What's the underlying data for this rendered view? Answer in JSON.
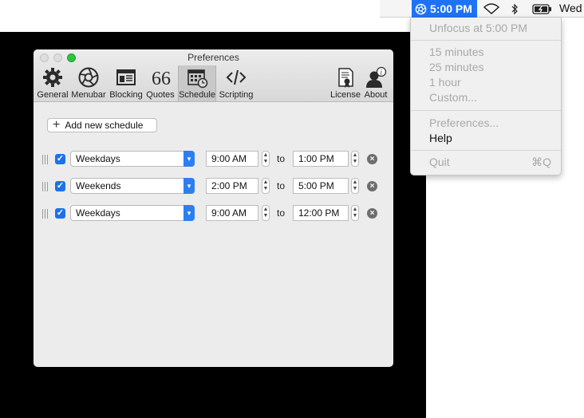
{
  "menubar": {
    "status_time": "5:00 PM",
    "clock": "Wed",
    "icons": [
      "focus-icon",
      "wifi-icon",
      "bluetooth-icon",
      "battery-icon"
    ]
  },
  "menu": {
    "unfocus_label": "Unfocus at 5:00 PM",
    "durations": [
      "15 minutes",
      "25 minutes",
      "1 hour",
      "Custom..."
    ],
    "preferences": "Preferences...",
    "help": "Help",
    "quit": "Quit",
    "quit_shortcut": "⌘Q"
  },
  "window": {
    "title": "Preferences",
    "toolbar": [
      {
        "label": "General",
        "icon": "gear-icon"
      },
      {
        "label": "Menubar",
        "icon": "aperture-icon"
      },
      {
        "label": "Blocking",
        "icon": "browser-window-icon"
      },
      {
        "label": "Quotes",
        "icon": "quote-icon"
      },
      {
        "label": "Schedule",
        "icon": "calendar-clock-icon"
      },
      {
        "label": "Scripting",
        "icon": "code-icon"
      },
      {
        "label": "License",
        "icon": "certificate-icon"
      },
      {
        "label": "About",
        "icon": "person-info-icon"
      }
    ],
    "selected_tab": "Schedule",
    "add_schedule_label": "Add new schedule",
    "schedules": [
      {
        "days": "Weekdays",
        "start": "9:00 AM",
        "to": "to",
        "end": "1:00 PM",
        "enabled": true
      },
      {
        "days": "Weekends",
        "start": "2:00 PM",
        "to": "to",
        "end": "5:00 PM",
        "enabled": true
      },
      {
        "days": "Weekdays",
        "start": "9:00 AM",
        "to": "to",
        "end": "12:00 PM",
        "enabled": true
      }
    ]
  },
  "colors": {
    "accent": "#1e73f5",
    "window_bg": "#ececec",
    "disabled_text": "#a8a8a8"
  }
}
